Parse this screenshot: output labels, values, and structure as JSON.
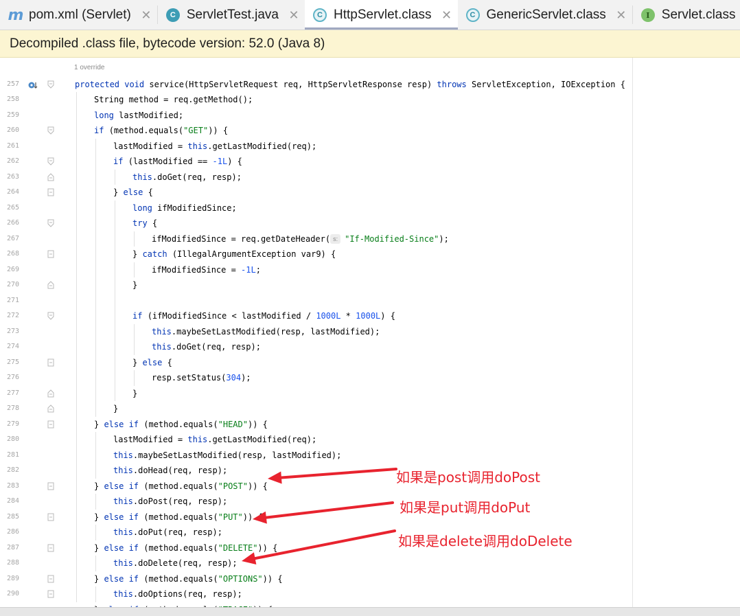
{
  "tabs": [
    {
      "label": "pom.xml (Servlet)",
      "icon": "maven-icon",
      "icon_text": "m",
      "active": false
    },
    {
      "label": "ServletTest.java",
      "icon": "class-icon",
      "icon_text": "C",
      "active": false
    },
    {
      "label": "HttpServlet.class",
      "icon": "class-file-icon",
      "icon_text": "C",
      "active": true
    },
    {
      "label": "GenericServlet.class",
      "icon": "class-file-icon",
      "icon_text": "C",
      "active": false
    },
    {
      "label": "Servlet.class",
      "icon": "interface-icon",
      "icon_text": "I",
      "active": false
    }
  ],
  "close_glyph": "✕",
  "banner": "Decompiled .class file, bytecode version: 52.0 (Java 8)",
  "editor": {
    "hint": "1 override",
    "param_hint": "s:",
    "lines": [
      {
        "n": "257",
        "indent": 0,
        "tokens": [
          [
            "kw",
            "protected "
          ],
          [
            "kw",
            "void "
          ],
          [
            "",
            "service(HttpServletRequest req, HttpServletResponse resp) "
          ],
          [
            "kw",
            "throws "
          ],
          [
            "",
            "ServletException, IOException {"
          ]
        ]
      },
      {
        "n": "258",
        "indent": 1,
        "tokens": [
          [
            "",
            "String method = req.getMethod();"
          ]
        ]
      },
      {
        "n": "259",
        "indent": 1,
        "tokens": [
          [
            "kw",
            "long "
          ],
          [
            "",
            "lastModified;"
          ]
        ]
      },
      {
        "n": "260",
        "indent": 1,
        "tokens": [
          [
            "kw",
            "if "
          ],
          [
            "",
            "(method.equals("
          ],
          [
            "str",
            "\"GET\""
          ],
          [
            "",
            ")) {"
          ]
        ]
      },
      {
        "n": "261",
        "indent": 2,
        "tokens": [
          [
            "",
            "lastModified = "
          ],
          [
            "kw",
            "this"
          ],
          [
            "",
            ".getLastModified(req);"
          ]
        ]
      },
      {
        "n": "262",
        "indent": 2,
        "tokens": [
          [
            "kw",
            "if "
          ],
          [
            "",
            "(lastModified == "
          ],
          [
            "num",
            "-1L"
          ],
          [
            "",
            ") {"
          ]
        ]
      },
      {
        "n": "263",
        "indent": 3,
        "tokens": [
          [
            "kw",
            "this"
          ],
          [
            "",
            ".doGet(req, resp);"
          ]
        ]
      },
      {
        "n": "264",
        "indent": 2,
        "tokens": [
          [
            "",
            "} "
          ],
          [
            "kw",
            "else "
          ],
          [
            "",
            "{"
          ]
        ]
      },
      {
        "n": "265",
        "indent": 3,
        "tokens": [
          [
            "kw",
            "long "
          ],
          [
            "",
            "ifModifiedSince;"
          ]
        ]
      },
      {
        "n": "266",
        "indent": 3,
        "tokens": [
          [
            "kw",
            "try "
          ],
          [
            "",
            "{"
          ]
        ]
      },
      {
        "n": "267",
        "indent": 4,
        "tokens": [
          [
            "",
            "ifModifiedSince = req.getDateHeader("
          ],
          [
            "hint",
            ""
          ],
          [
            "str",
            "\"If-Modified-Since\""
          ],
          [
            "",
            ");"
          ]
        ]
      },
      {
        "n": "268",
        "indent": 3,
        "tokens": [
          [
            "",
            "} "
          ],
          [
            "kw",
            "catch "
          ],
          [
            "",
            "(IllegalArgumentException var9) {"
          ]
        ]
      },
      {
        "n": "269",
        "indent": 4,
        "tokens": [
          [
            "",
            "ifModifiedSince = "
          ],
          [
            "num",
            "-1L"
          ],
          [
            "",
            ";"
          ]
        ]
      },
      {
        "n": "270",
        "indent": 3,
        "tokens": [
          [
            "",
            "}"
          ]
        ]
      },
      {
        "n": "271",
        "indent": 0,
        "tokens": []
      },
      {
        "n": "272",
        "indent": 3,
        "tokens": [
          [
            "kw",
            "if "
          ],
          [
            "",
            "(ifModifiedSince < lastModified / "
          ],
          [
            "num",
            "1000L"
          ],
          [
            "",
            " * "
          ],
          [
            "num",
            "1000L"
          ],
          [
            "",
            ") {"
          ]
        ]
      },
      {
        "n": "273",
        "indent": 4,
        "tokens": [
          [
            "kw",
            "this"
          ],
          [
            "",
            ".maybeSetLastModified(resp, lastModified);"
          ]
        ]
      },
      {
        "n": "274",
        "indent": 4,
        "tokens": [
          [
            "kw",
            "this"
          ],
          [
            "",
            ".doGet(req, resp);"
          ]
        ]
      },
      {
        "n": "275",
        "indent": 3,
        "tokens": [
          [
            "",
            "} "
          ],
          [
            "kw",
            "else "
          ],
          [
            "",
            "{"
          ]
        ]
      },
      {
        "n": "276",
        "indent": 4,
        "tokens": [
          [
            "",
            "resp.setStatus("
          ],
          [
            "num",
            "304"
          ],
          [
            "",
            ");"
          ]
        ]
      },
      {
        "n": "277",
        "indent": 3,
        "tokens": [
          [
            "",
            "}"
          ]
        ]
      },
      {
        "n": "278",
        "indent": 2,
        "tokens": [
          [
            "",
            "}"
          ]
        ]
      },
      {
        "n": "279",
        "indent": 1,
        "tokens": [
          [
            "",
            "} "
          ],
          [
            "kw",
            "else if "
          ],
          [
            "",
            "(method.equals("
          ],
          [
            "str",
            "\"HEAD\""
          ],
          [
            "",
            ")) {"
          ]
        ]
      },
      {
        "n": "280",
        "indent": 2,
        "tokens": [
          [
            "",
            "lastModified = "
          ],
          [
            "kw",
            "this"
          ],
          [
            "",
            ".getLastModified(req);"
          ]
        ]
      },
      {
        "n": "281",
        "indent": 2,
        "tokens": [
          [
            "kw",
            "this"
          ],
          [
            "",
            ".maybeSetLastModified(resp, lastModified);"
          ]
        ]
      },
      {
        "n": "282",
        "indent": 2,
        "tokens": [
          [
            "kw",
            "this"
          ],
          [
            "",
            ".doHead(req, resp);"
          ]
        ]
      },
      {
        "n": "283",
        "indent": 1,
        "tokens": [
          [
            "",
            "} "
          ],
          [
            "kw",
            "else if "
          ],
          [
            "",
            "(method.equals("
          ],
          [
            "str",
            "\"POST\""
          ],
          [
            "",
            ")) {"
          ]
        ]
      },
      {
        "n": "284",
        "indent": 2,
        "tokens": [
          [
            "kw",
            "this"
          ],
          [
            "",
            ".doPost(req, resp);"
          ]
        ]
      },
      {
        "n": "285",
        "indent": 1,
        "tokens": [
          [
            "",
            "} "
          ],
          [
            "kw",
            "else if "
          ],
          [
            "",
            "(method.equals("
          ],
          [
            "str",
            "\"PUT\""
          ],
          [
            "",
            ")) {"
          ]
        ]
      },
      {
        "n": "286",
        "indent": 2,
        "tokens": [
          [
            "kw",
            "this"
          ],
          [
            "",
            ".doPut(req, resp);"
          ]
        ]
      },
      {
        "n": "287",
        "indent": 1,
        "tokens": [
          [
            "",
            "} "
          ],
          [
            "kw",
            "else if "
          ],
          [
            "",
            "(method.equals("
          ],
          [
            "str",
            "\"DELETE\""
          ],
          [
            "",
            ")) {"
          ]
        ]
      },
      {
        "n": "288",
        "indent": 2,
        "tokens": [
          [
            "kw",
            "this"
          ],
          [
            "",
            ".doDelete(req, resp);"
          ]
        ]
      },
      {
        "n": "289",
        "indent": 1,
        "tokens": [
          [
            "",
            "} "
          ],
          [
            "kw",
            "else if "
          ],
          [
            "",
            "(method.equals("
          ],
          [
            "str",
            "\"OPTIONS\""
          ],
          [
            "",
            ")) {"
          ]
        ]
      },
      {
        "n": "290",
        "indent": 2,
        "tokens": [
          [
            "kw",
            "this"
          ],
          [
            "",
            ".doOptions(req, resp);"
          ]
        ]
      },
      {
        "n": "",
        "indent": 1,
        "tokens": [
          [
            "",
            "} "
          ],
          [
            "kw",
            "else if "
          ],
          [
            "",
            "(method.equals("
          ],
          [
            "str",
            "\"TRACE\""
          ],
          [
            "",
            ")) {"
          ]
        ]
      }
    ]
  },
  "annotations": [
    {
      "text": "如果是post调用doPost",
      "line": "283"
    },
    {
      "text": "如果是put调用doPut",
      "line": "285"
    },
    {
      "text": "如果是delete调用doDelete",
      "line": "288"
    }
  ],
  "colors": {
    "keyword": "#0033b3",
    "string": "#067d17",
    "number": "#1750eb",
    "annotation": "#e8232e",
    "banner_bg": "#fcf5d2"
  }
}
